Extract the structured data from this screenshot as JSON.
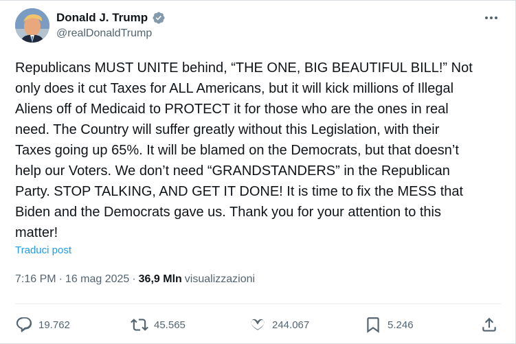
{
  "author": {
    "name": "Donald J. Trump",
    "handle": "@realDonaldTrump",
    "verified": true,
    "verified_color": "#829aab"
  },
  "post": {
    "text": "Republicans MUST UNITE behind, “THE ONE, BIG BEAUTIFUL BILL!” Not\nonly does it cut Taxes for ALL Americans, but it will kick millions of Illegal\nAliens off of Medicaid to PROTECT it for those who are the ones in real\nneed. The Country will suffer greatly without this Legislation, with their\nTaxes going up 65%. It will be blamed on the Democrats, but that doesn’t\nhelp our Voters. We don’t need “GRANDSTANDERS” in the Republican\nParty. STOP TALKING, AND GET IT DONE! It is time to fix the MESS that\nBiden and the Democrats gave us. Thank you for your attention to this\nmatter!",
    "translate_label": "Traduci post",
    "time": "7:16 PM",
    "separator": "·",
    "date": "16 mag 2025",
    "views_count": "36,9 Mln",
    "views_label": "visualizzazioni"
  },
  "actions": {
    "replies": "19.762",
    "reposts": "45.565",
    "likes": "244.067",
    "bookmarks": "5.246"
  },
  "colors": {
    "text": "#0f1419",
    "secondary": "#536471",
    "link": "#1d9bf0",
    "divider": "#e6ecf0"
  },
  "icons": [
    "more-icon",
    "verified-badge-icon",
    "reply-icon",
    "repost-icon",
    "like-icon",
    "bookmark-icon",
    "share-icon"
  ]
}
